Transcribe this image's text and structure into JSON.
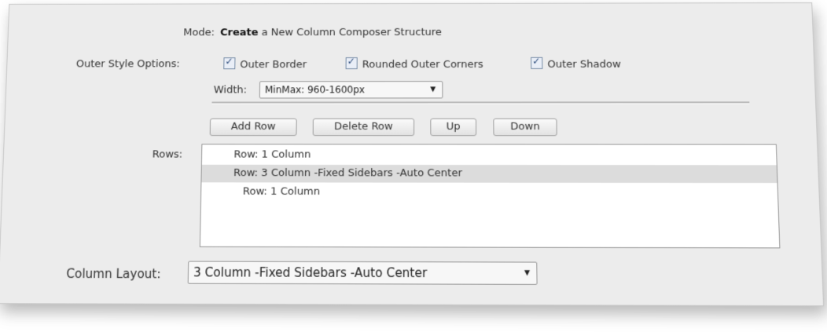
{
  "mode": {
    "label": "Mode:",
    "value_bold": "Create",
    "value_rest": "a New Column Composer Structure"
  },
  "outer_style": {
    "label": "Outer Style Options:",
    "options": [
      {
        "label": "Outer Border",
        "checked": true
      },
      {
        "label": "Rounded Outer Corners",
        "checked": true
      },
      {
        "label": "Outer Shadow",
        "checked": true
      }
    ]
  },
  "width": {
    "label": "Width:",
    "value": "MinMax: 960-1600px"
  },
  "buttons": {
    "add_row": "Add Row",
    "delete_row": "Delete Row",
    "up": "Up",
    "down": "Down"
  },
  "rows": {
    "label": "Rows:",
    "items": [
      {
        "label": "Row: 1 Column",
        "selected": false
      },
      {
        "label": "Row: 3 Column -Fixed Sidebars -Auto Center",
        "selected": true
      },
      {
        "label": "Row: 1 Column",
        "selected": false
      }
    ]
  },
  "column_layout": {
    "label": "Column Layout:",
    "value": "3 Column -Fixed Sidebars -Auto Center"
  },
  "icons": {
    "checkbox": "checkmark-icon",
    "dropdown": "chevron-down-icon"
  }
}
